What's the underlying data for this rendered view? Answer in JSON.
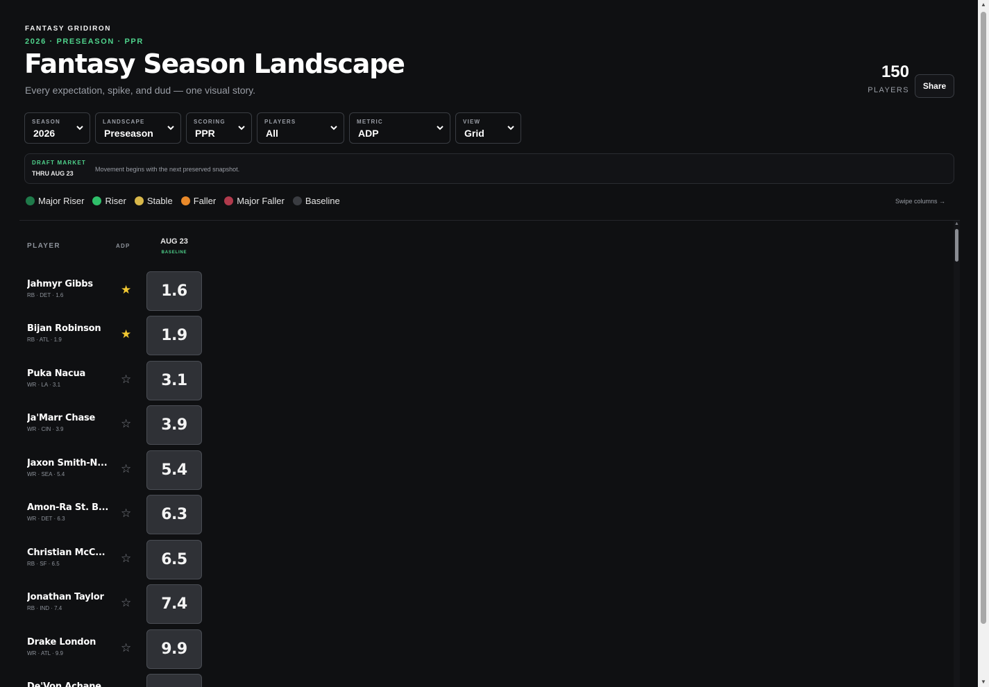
{
  "header": {
    "brand": "FANTASY GRIDIRON",
    "eyebrow": "2026 · PRESEASON · PPR",
    "title": "Fantasy Season Landscape",
    "subtitle": "Every expectation, spike, and dud — one visual story.",
    "count": "150",
    "count_label": "PLAYERS",
    "share_label": "Share"
  },
  "filters": [
    {
      "label": "SEASON",
      "value": "2026"
    },
    {
      "label": "LANDSCAPE",
      "value": "Preseason"
    },
    {
      "label": "SCORING",
      "value": "PPR"
    },
    {
      "label": "PLAYERS",
      "value": "All"
    },
    {
      "label": "METRIC",
      "value": "ADP"
    },
    {
      "label": "VIEW",
      "value": "Grid"
    }
  ],
  "market": {
    "label": "DRAFT MARKET",
    "date": "THRU AUG 23",
    "note": "Movement begins with the next preserved snapshot."
  },
  "legend": [
    {
      "label": "Major Riser",
      "color": "#1f7a4a"
    },
    {
      "label": "Riser",
      "color": "#2fbf6a"
    },
    {
      "label": "Stable",
      "color": "#d8b74a"
    },
    {
      "label": "Faller",
      "color": "#e8892a"
    },
    {
      "label": "Major Faller",
      "color": "#b03a4c"
    },
    {
      "label": "Baseline",
      "color": "#3a3c41"
    }
  ],
  "swipe_hint": "Swipe columns →",
  "grid": {
    "player_header": "PLAYER",
    "adp_header": "ADP",
    "column": {
      "date": "AUG 23",
      "tag": "BASELINE"
    },
    "rows": [
      {
        "name": "Jahmyr Gibbs",
        "meta": "RB · DET · 1.6",
        "starred": true,
        "value": "1.6"
      },
      {
        "name": "Bijan Robinson",
        "meta": "RB · ATL · 1.9",
        "starred": true,
        "value": "1.9"
      },
      {
        "name": "Puka Nacua",
        "meta": "WR · LA · 3.1",
        "starred": false,
        "value": "3.1"
      },
      {
        "name": "Ja'Marr Chase",
        "meta": "WR · CIN · 3.9",
        "starred": false,
        "value": "3.9"
      },
      {
        "name": "Jaxon Smith-N...",
        "meta": "WR · SEA · 5.4",
        "starred": false,
        "value": "5.4"
      },
      {
        "name": "Amon-Ra St. B...",
        "meta": "WR · DET · 6.3",
        "starred": false,
        "value": "6.3"
      },
      {
        "name": "Christian McC...",
        "meta": "RB · SF · 6.5",
        "starred": false,
        "value": "6.5"
      },
      {
        "name": "Jonathan Taylor",
        "meta": "RB · IND · 7.4",
        "starred": false,
        "value": "7.4"
      },
      {
        "name": "Drake London",
        "meta": "WR · ATL · 9.9",
        "starred": false,
        "value": "9.9"
      },
      {
        "name": "De'Von Achane",
        "meta": "",
        "starred": false,
        "value": ""
      }
    ]
  }
}
